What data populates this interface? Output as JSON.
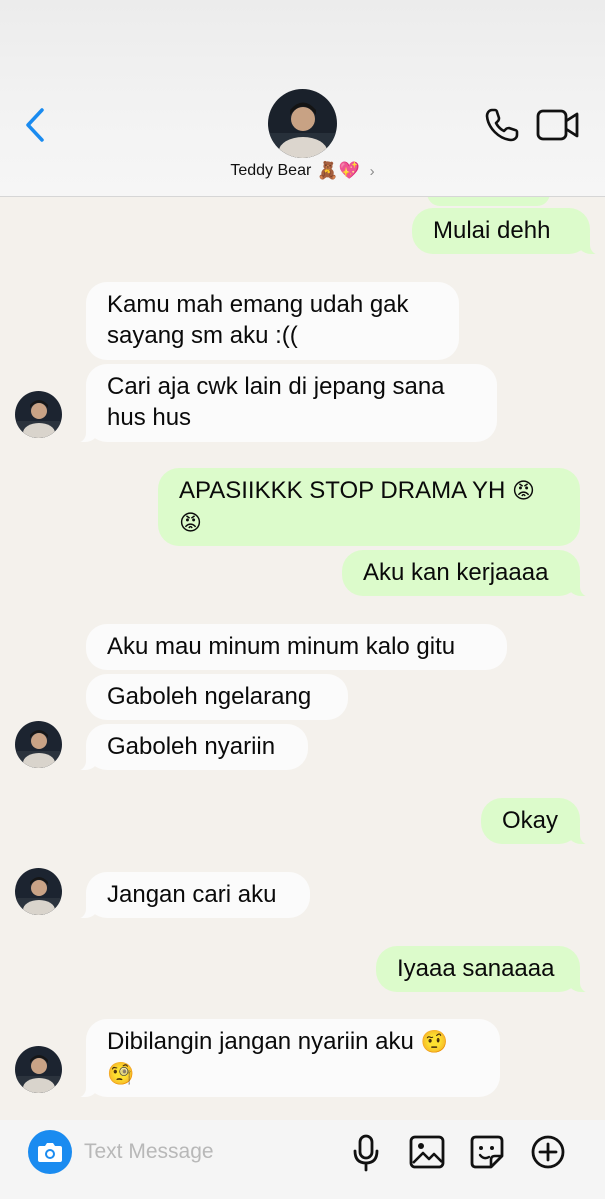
{
  "header": {
    "contact_name": "Teddy Bear",
    "name_emojis": "🧸💖",
    "chevron": "›"
  },
  "messages": [
    {
      "side": "out",
      "text": "Mulai dehh"
    },
    {
      "side": "in",
      "text": "Kamu mah emang udah gak sayang sm aku :(("
    },
    {
      "side": "in",
      "text": "Cari aja cwk lain di jepang sana hus hus"
    },
    {
      "side": "out",
      "text": "APASIIKKK STOP DRAMA YH",
      "emoji": "😡 😡"
    },
    {
      "side": "out",
      "text": "Aku kan kerjaaaa"
    },
    {
      "side": "in",
      "text": "Aku mau minum minum kalo gitu"
    },
    {
      "side": "in",
      "text": "Gaboleh ngelarang"
    },
    {
      "side": "in",
      "text": "Gaboleh nyariin"
    },
    {
      "side": "out",
      "text": "Okay"
    },
    {
      "side": "in",
      "text": "Jangan cari aku"
    },
    {
      "side": "out",
      "text": "Iyaaa sanaaaa"
    },
    {
      "side": "in",
      "text": "Dibilangin jangan nyariin aku",
      "emoji": "🤨 🧐"
    }
  ],
  "input": {
    "placeholder": "Text Message"
  },
  "icons": {
    "back": "chevron-left-icon",
    "phone": "phone-icon",
    "video": "video-camera-icon",
    "camera": "camera-icon",
    "mic": "microphone-icon",
    "photo": "photo-library-icon",
    "sticker": "sticker-icon",
    "plus": "plus-circle-icon"
  },
  "colors": {
    "accent": "#1a8bf0",
    "outgoing_bubble": "#dcfbcb",
    "incoming_bubble": "#fbfbfb",
    "chat_background": "#f4f1ec"
  }
}
